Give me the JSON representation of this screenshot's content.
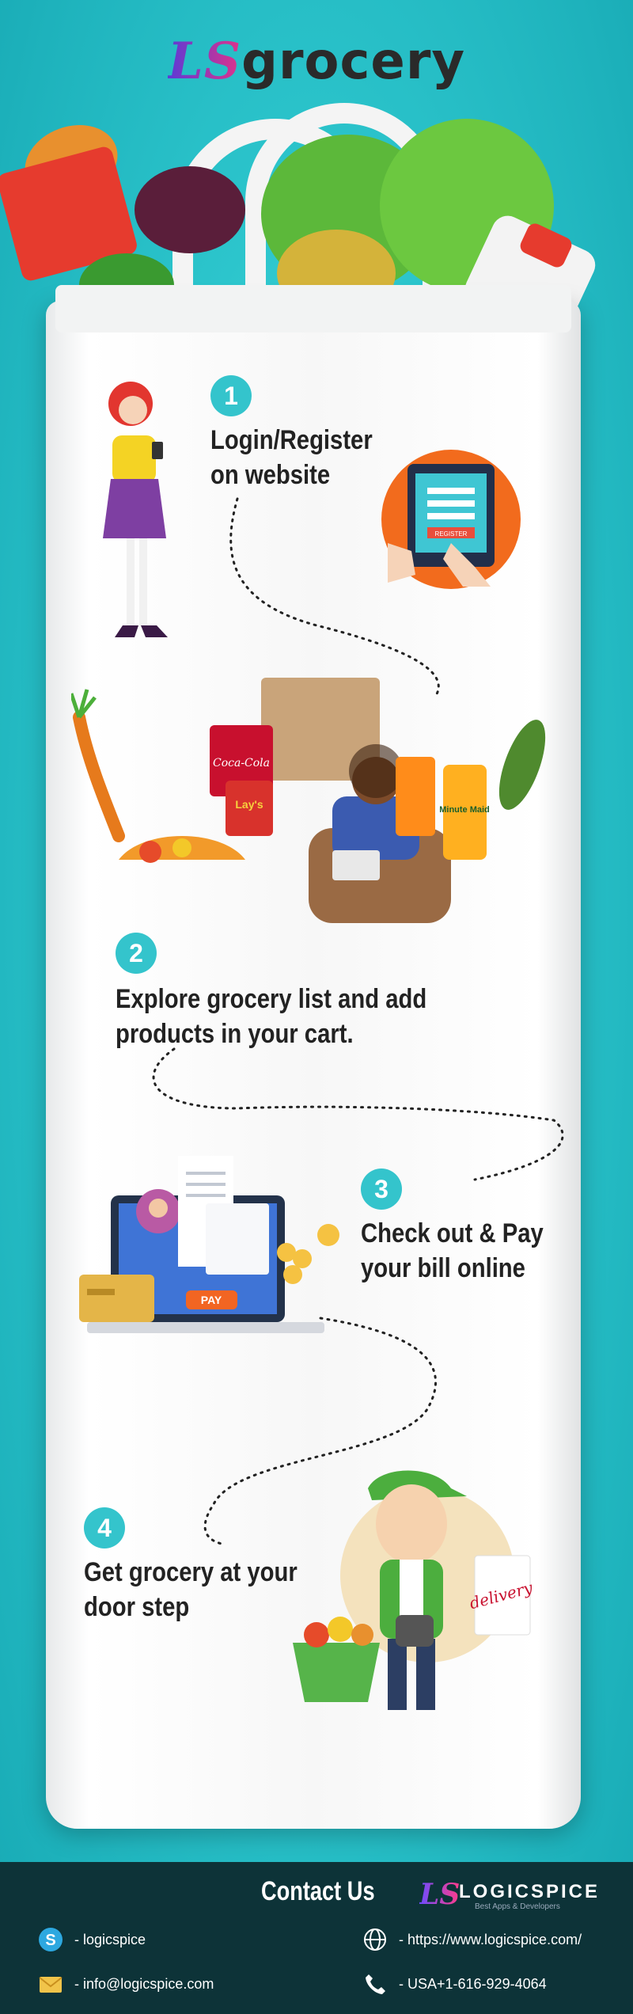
{
  "brand": {
    "logo_ls": "LS",
    "logo_word": "grocery"
  },
  "steps": [
    {
      "number": "1",
      "line1": "Login/Register",
      "line2": "on website",
      "tablet_button": "REGISTER"
    },
    {
      "number": "2",
      "line1": "Explore grocery list and add",
      "line2": "products in your cart.",
      "brand_labels": [
        "Coca-Cola",
        "Lay's",
        "Minute Maid"
      ]
    },
    {
      "number": "3",
      "line1": "Check out & Pay",
      "line2": "your bill online",
      "pay_button": "PAY"
    },
    {
      "number": "4",
      "line1": "Get grocery at your",
      "line2": "door step",
      "delivery_label": "delivery"
    }
  ],
  "footer": {
    "title": "Contact Us",
    "brand_ls": "LS",
    "brand_name": "LOGICSPICE",
    "brand_tagline": "Best Apps & Developers",
    "skype": "- logicspice",
    "website": "- https://www.logicspice.com/",
    "email": "- info@logicspice.com",
    "phone": "- USA+1-616-929-4064"
  },
  "colors": {
    "accent": "#34c4cc",
    "background": "#2cc5cc",
    "footer": "#0d3338",
    "pay_button": "#f26522",
    "register_button": "#e94e3c"
  },
  "icons": [
    "skype-icon",
    "globe-icon",
    "mail-icon",
    "phone-icon"
  ]
}
